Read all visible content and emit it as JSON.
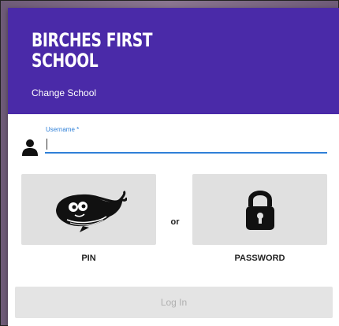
{
  "header": {
    "school_name": "BIRCHES FIRST SCHOOL",
    "change_school_label": "Change School",
    "background_color": "#4a2aa8"
  },
  "login": {
    "username_label": "Username *",
    "username_value": "",
    "user_icon": "person-icon"
  },
  "methods": {
    "pin": {
      "label": "PIN",
      "icon": "whale-icon"
    },
    "separator": "or",
    "password": {
      "label": "PASSWORD",
      "icon": "lock-icon"
    }
  },
  "actions": {
    "login_label": "Log In",
    "login_enabled": false
  },
  "colors": {
    "accent": "#2f80d8",
    "tile": "#e0e0e0"
  }
}
